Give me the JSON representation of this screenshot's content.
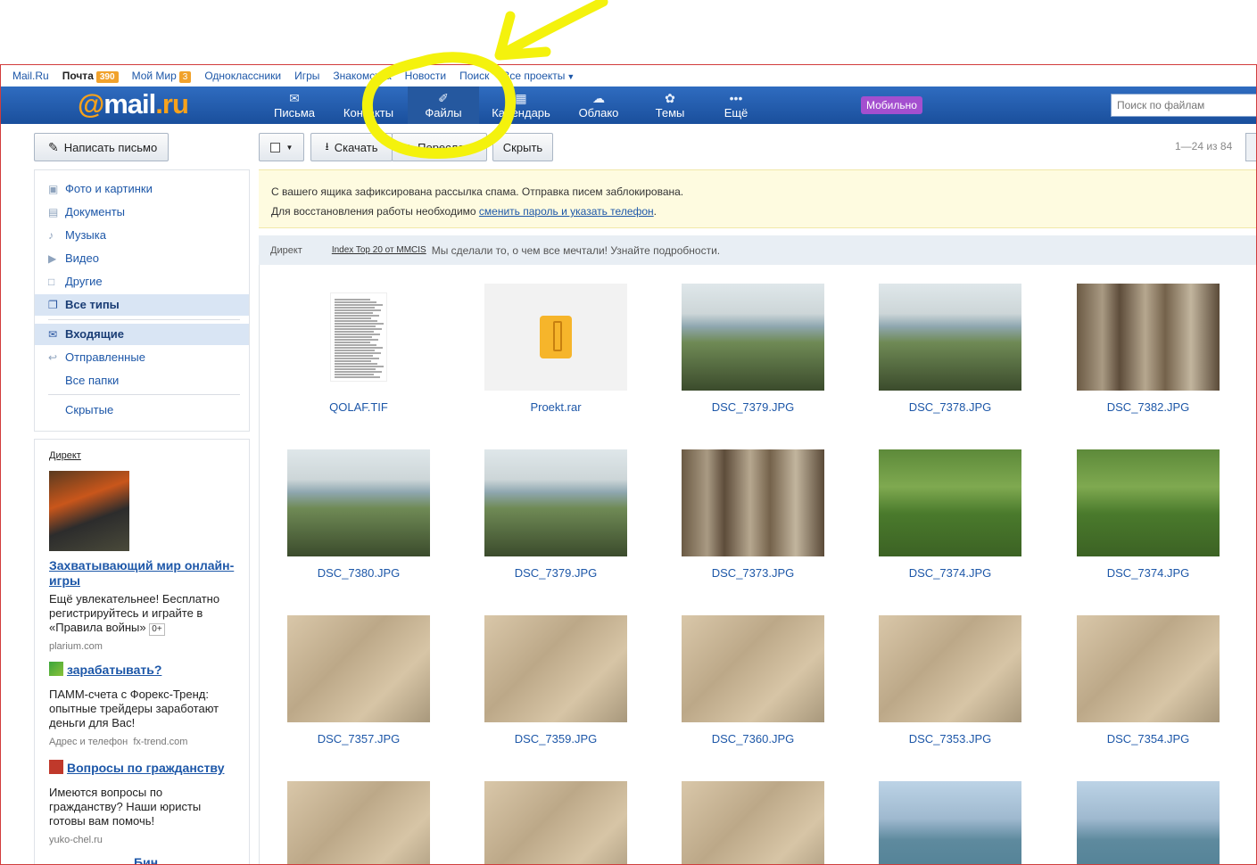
{
  "portal": {
    "links": [
      "Mail.Ru",
      "Почта",
      "Мой Мир",
      "Одноклассники",
      "Игры",
      "Знакомства",
      "Новости",
      "Поиск",
      "Все проекты"
    ],
    "mail_count": "390",
    "myworld_count": "3"
  },
  "header": {
    "logo_at": "@",
    "logo_mail": "mail",
    "logo_ru": ".ru",
    "nav": [
      {
        "label": "Письма",
        "icon": "envelope-icon"
      },
      {
        "label": "Контакты",
        "icon": "contacts-icon"
      },
      {
        "label": "Файлы",
        "icon": "paperclip-icon"
      },
      {
        "label": "Календарь",
        "icon": "calendar-icon"
      },
      {
        "label": "Облако",
        "icon": "cloud-icon"
      },
      {
        "label": "Темы",
        "icon": "palette-icon"
      },
      {
        "label": "Ещё",
        "icon": "more-dots-icon"
      }
    ],
    "active_nav": "Файлы",
    "mobile_label": "Мобильно",
    "search_placeholder": "Поиск по файлам"
  },
  "sidebar": {
    "compose_label": "Написать письмо",
    "types": [
      {
        "label": "Фото и картинки",
        "icon": "image-icon"
      },
      {
        "label": "Документы",
        "icon": "document-icon"
      },
      {
        "label": "Музыка",
        "icon": "music-icon"
      },
      {
        "label": "Видео",
        "icon": "video-icon"
      },
      {
        "label": "Другие",
        "icon": "file-icon"
      },
      {
        "label": "Все типы",
        "icon": "all-files-icon"
      }
    ],
    "folders": [
      {
        "label": "Входящие",
        "icon": "inbox-icon"
      },
      {
        "label": "Отправленные",
        "icon": "sent-icon"
      },
      {
        "label": "Все папки",
        "icon": ""
      },
      {
        "label": "Скрытые",
        "icon": ""
      }
    ]
  },
  "ads": {
    "head": "Директ",
    "ad1": {
      "title": "Захватывающий мир онлайн-игры",
      "text": "Ещё увлекательнее! Бесплатно регистрируйтесь и играйте в «Правила войны»",
      "age": "0+",
      "source": "plarium.com"
    },
    "ad2": {
      "title": "зарабатывать?",
      "text": "ПАММ-счета с Форекс-Тренд: опытные трейдеры заработают деньги для Вас!",
      "source_prefix": "Адрес и телефон",
      "source": "fx-trend.com"
    },
    "ad3": {
      "title": "Вопросы по гражданству",
      "text": "Имеются вопросы по гражданству? Наши юристы готовы вам помочь!",
      "source": "yuko-chel.ru"
    },
    "ad4": {
      "title": "Бин"
    }
  },
  "toolbar": {
    "download_label": "Скачать",
    "forward_label": "Переслать",
    "hide_label": "Скрыть",
    "page_info": "1—24 из 84"
  },
  "warning": {
    "line1": "С вашего ящика зафиксирована рассылка спама. Отправка писем заблокирована.",
    "line2_prefix": "Для восстановления работы необходимо ",
    "line2_link": "сменить пароль и указать телефон",
    "line2_suffix": "."
  },
  "direct_strip": {
    "label": "Директ",
    "title": "Index Top 20 от MMCIS",
    "text": "Мы сделали то, о чем все мечтали! Узнайте подробности."
  },
  "files": [
    {
      "name": "QOLAF.TIF",
      "kind": "document"
    },
    {
      "name": "Proekt.rar",
      "kind": "archive"
    },
    {
      "name": "DSC_7379.JPG",
      "kind": "photo",
      "scene": "lake"
    },
    {
      "name": "DSC_7378.JPG",
      "kind": "photo",
      "scene": "lake"
    },
    {
      "name": "DSC_7382.JPG",
      "kind": "photo",
      "scene": "forest"
    },
    {
      "name": "DSC_7380.JPG",
      "kind": "photo",
      "scene": "lake"
    },
    {
      "name": "DSC_7379.JPG",
      "kind": "photo",
      "scene": "lake"
    },
    {
      "name": "DSC_7373.JPG",
      "kind": "photo",
      "scene": "forest"
    },
    {
      "name": "DSC_7374.JPG",
      "kind": "photo",
      "scene": "reeds"
    },
    {
      "name": "DSC_7374.JPG",
      "kind": "photo",
      "scene": "reeds"
    },
    {
      "name": "DSC_7357.JPG",
      "kind": "photo",
      "scene": "sand"
    },
    {
      "name": "DSC_7359.JPG",
      "kind": "photo",
      "scene": "sand"
    },
    {
      "name": "DSC_7360.JPG",
      "kind": "photo",
      "scene": "sand"
    },
    {
      "name": "DSC_7353.JPG",
      "kind": "photo",
      "scene": "sand"
    },
    {
      "name": "DSC_7354.JPG",
      "kind": "photo",
      "scene": "sand"
    },
    {
      "name": "",
      "kind": "photo",
      "scene": "sand"
    },
    {
      "name": "",
      "kind": "photo",
      "scene": "sand"
    },
    {
      "name": "",
      "kind": "photo",
      "scene": "sand"
    },
    {
      "name": "",
      "kind": "photo",
      "scene": "beach"
    },
    {
      "name": "",
      "kind": "photo",
      "scene": "beach"
    }
  ],
  "colors": {
    "header_blue": "#1a4f9c",
    "link_blue": "#1d57a8",
    "counter_orange": "#f1a22c",
    "annotation_yellow": "#f4f20d",
    "frame_red": "#d23c3c"
  }
}
